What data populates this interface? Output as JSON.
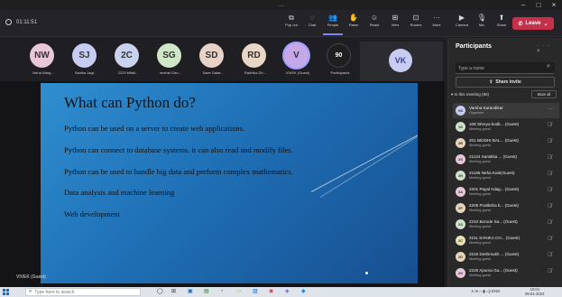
{
  "titlebar": {
    "center": "...",
    "minimize": "–",
    "maximize": "□",
    "close": "×"
  },
  "toolbar": {
    "timer": "01:11:51",
    "buttons": [
      {
        "icon": "pop-out-icon",
        "glyph": "⧉",
        "label": "Pop out"
      },
      {
        "icon": "chat-icon",
        "glyph": "◌",
        "label": "Chat"
      },
      {
        "icon": "people-icon",
        "glyph": "👥",
        "label": "People"
      },
      {
        "icon": "raise-hand-icon",
        "glyph": "✋",
        "label": "Raise"
      },
      {
        "icon": "react-icon",
        "glyph": "☺",
        "label": "React"
      },
      {
        "icon": "view-icon",
        "glyph": "⊞",
        "label": "View"
      },
      {
        "icon": "rooms-icon",
        "glyph": "⊡",
        "label": "Rooms"
      },
      {
        "icon": "more-icon",
        "glyph": "···",
        "label": "More"
      },
      {
        "icon": "camera-icon",
        "glyph": "▶",
        "label": "Camera"
      },
      {
        "icon": "mic-icon",
        "glyph": "🎙",
        "label": "Mic"
      },
      {
        "icon": "share-icon",
        "glyph": "⬆",
        "label": "Share"
      }
    ],
    "leave_label": "Leave",
    "leave_glyph": "✆"
  },
  "strip": {
    "tiles": [
      {
        "initials": "NW",
        "color": "#e9c6d8",
        "name": "Neha Warg..."
      },
      {
        "initials": "SJ",
        "color": "#c7cdf2",
        "name": "Sanika Jagt..."
      },
      {
        "initials": "2C",
        "color": "#c9d3f0",
        "name": "2229 Mitali..."
      },
      {
        "initials": "SG",
        "color": "#cfe7c7",
        "name": "snehal Gan..."
      },
      {
        "initials": "SD",
        "color": "#e8d2c7",
        "name": "Saee Dalar..."
      },
      {
        "initials": "RD",
        "color": "#e8d6c6",
        "name": "Radhika Dh..."
      },
      {
        "initials": "V",
        "color": "#c6a8e8",
        "name": "VIVEK (Guest)"
      },
      {
        "initials": "90",
        "color": "#1f1f1f",
        "name": "Participants"
      }
    ],
    "featured": {
      "initials": "VK"
    }
  },
  "slide": {
    "title": "What can Python do?",
    "bullets": [
      "Python can be used on a server to create web applications.",
      "Python can connect to database systems. it can also read and modify files.",
      "Python can be used to handle big data and perform complex mathematics.",
      "Data analysis and machine learning",
      "Web development"
    ],
    "presenter": "VIVEK (Guest)"
  },
  "panel": {
    "title": "Participants",
    "actions": "···  ×",
    "search_placeholder": "Type a name",
    "share_invite": "Share invite",
    "section": "▾ In this meeting (90)",
    "mute_all": "Mute all",
    "participants": [
      {
        "initials": "VK",
        "color": "#c8cbf2",
        "name": "Varsha Karandikar",
        "role": "Organizer"
      },
      {
        "initials": "1S",
        "color": "#cde3c7",
        "name": "108 Shreya bodk... (Guest)",
        "role": "Meeting guest"
      },
      {
        "initials": "2B",
        "color": "#e6d3b8",
        "name": "201 BIDDHI BAL... (Guest)",
        "role": "Meeting guest"
      },
      {
        "initials": "2S",
        "color": "#e9c6d8",
        "name": "21124 Sanskka ... (Guest)",
        "role": "Meeting guest"
      },
      {
        "initials": "2N",
        "color": "#cde3c7",
        "name": "21165 Neha Kale(Guest)",
        "role": "Meeting guest"
      },
      {
        "initials": "2A",
        "color": "#e9c6d8",
        "name": "2201 Payal Adag... (Guest)",
        "role": "Meeting guest"
      },
      {
        "initials": "2P",
        "color": "#e6d3b8",
        "name": "2206 Pratiksha b... (Guest)",
        "role": "Meeting guest"
      },
      {
        "initials": "2S",
        "color": "#cde3c7",
        "name": "2210 Borude Sa... (Guest)",
        "role": "Meeting guest"
      },
      {
        "initials": "2C",
        "color": "#e8e2b3",
        "name": "2211 SANIKA CH... (Guest)",
        "role": "Meeting guest"
      },
      {
        "initials": "2D",
        "color": "#e6d3b8",
        "name": "2216 Deshmukh ... (Guest)",
        "role": "Meeting guest"
      },
      {
        "initials": "2G",
        "color": "#e9c6d8",
        "name": "2220 Apurva Ga... (Guest)",
        "role": "Meeting guest"
      }
    ]
  },
  "taskbar": {
    "search_placeholder": "Type here to search",
    "tray": "∧ ✉ ⌂ ▮ ◁) ENG",
    "time": "10:04",
    "date": "05-01-2022"
  }
}
